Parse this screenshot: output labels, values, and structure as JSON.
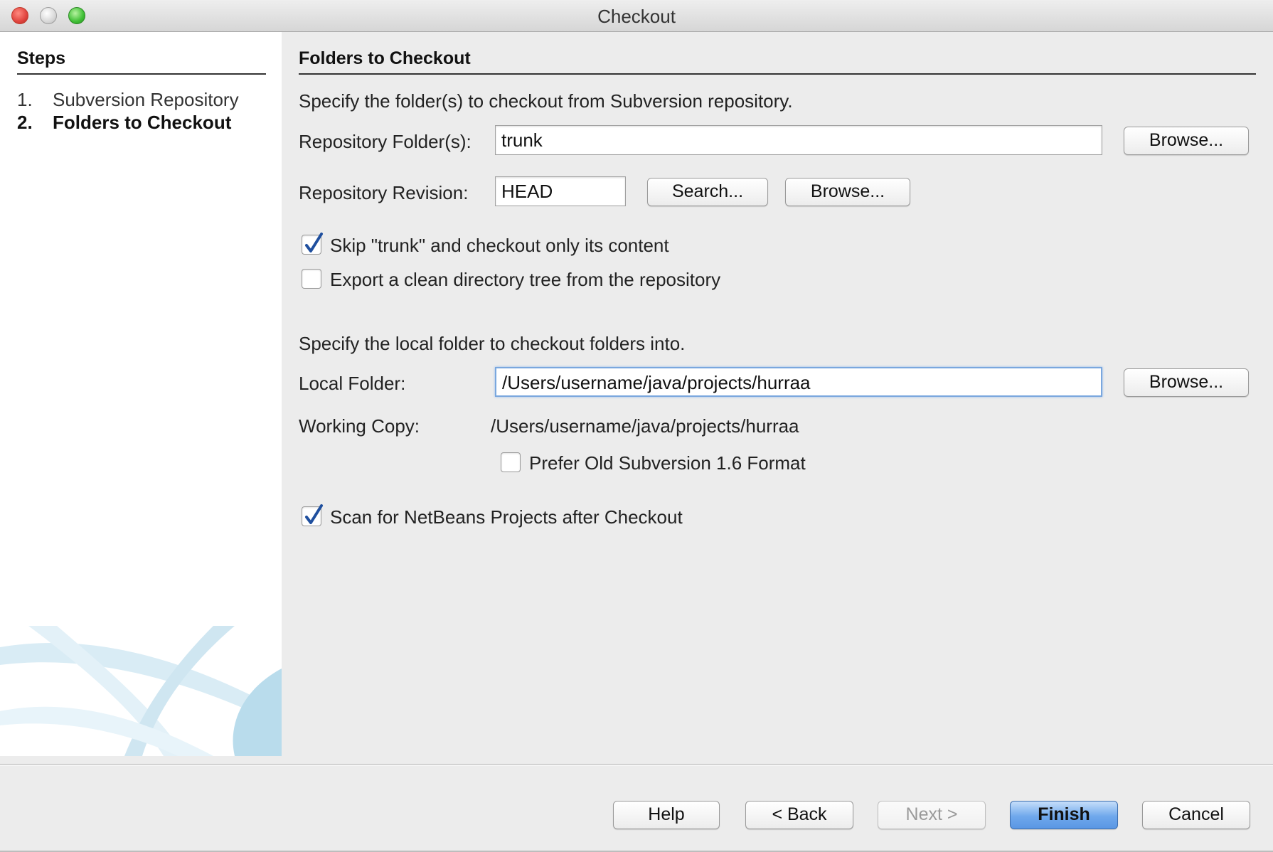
{
  "window": {
    "title": "Checkout"
  },
  "steps": {
    "heading": "Steps",
    "items": [
      {
        "number": "1.",
        "label": "Subversion Repository",
        "current": false
      },
      {
        "number": "2.",
        "label": "Folders to Checkout",
        "current": true
      }
    ]
  },
  "main": {
    "heading": "Folders to Checkout",
    "repo_instructions": "Specify the folder(s) to checkout from Subversion repository.",
    "repo_folder": {
      "label": "Repository Folder(s):",
      "value": "trunk",
      "browse_label": "Browse..."
    },
    "repo_revision": {
      "label": "Repository Revision:",
      "value": "HEAD",
      "search_label": "Search...",
      "browse_label": "Browse..."
    },
    "skip_trunk": {
      "label": "Skip \"trunk\" and checkout only its content",
      "checked": true
    },
    "export_clean": {
      "label": "Export a clean directory tree from the repository",
      "checked": false
    },
    "local_instructions": "Specify the local folder to checkout folders into.",
    "local_folder": {
      "label": "Local Folder:",
      "value": "/Users/username/java/projects/hurraa",
      "browse_label": "Browse..."
    },
    "working_copy": {
      "label": "Working Copy:",
      "value": "/Users/username/java/projects/hurraa"
    },
    "prefer_old_format": {
      "label": "Prefer Old Subversion 1.6 Format",
      "checked": false
    },
    "scan_projects": {
      "label": "Scan for NetBeans Projects after Checkout",
      "checked": true
    }
  },
  "footer": {
    "help_label": "Help",
    "back_label": "< Back",
    "next_label": "Next >",
    "finish_label": "Finish",
    "cancel_label": "Cancel"
  },
  "colors": {
    "accent": "#5a97e4",
    "panel": "#ececec",
    "focus_ring": "#7aa7de"
  }
}
